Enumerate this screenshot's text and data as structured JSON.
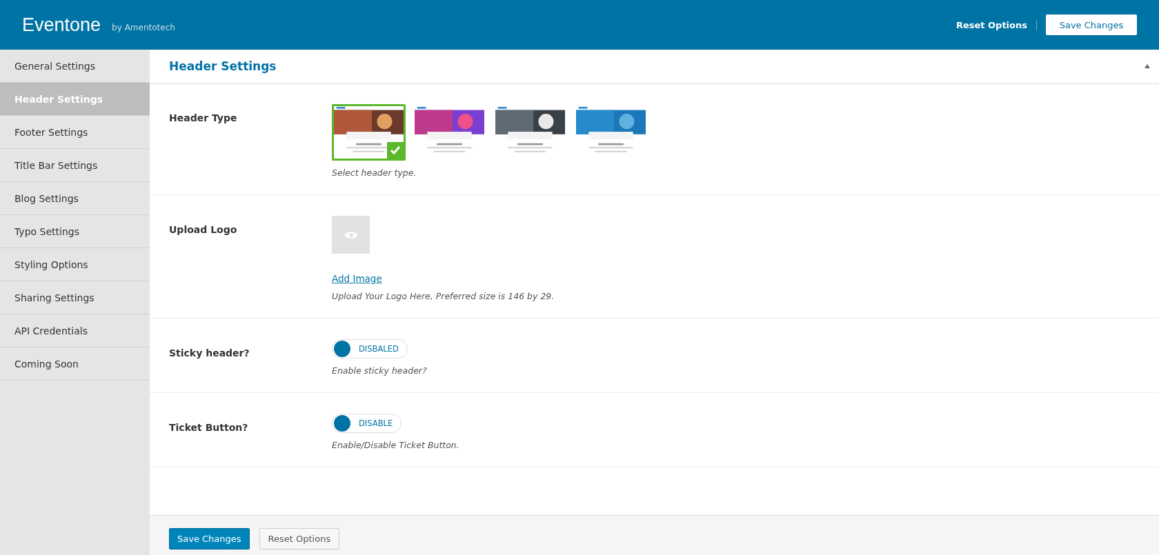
{
  "topbar": {
    "title": "Eventone",
    "subtitle": "by Amentotech",
    "reset_label": "Reset Options",
    "save_label": "Save Changes"
  },
  "sidebar": {
    "items": [
      {
        "label": "General Settings",
        "selected": false
      },
      {
        "label": "Header Settings",
        "selected": true
      },
      {
        "label": "Footer Settings",
        "selected": false
      },
      {
        "label": "Title Bar Settings",
        "selected": false
      },
      {
        "label": "Blog Settings",
        "selected": false
      },
      {
        "label": "Typo Settings",
        "selected": false
      },
      {
        "label": "Styling Options",
        "selected": false
      },
      {
        "label": "Sharing Settings",
        "selected": false
      },
      {
        "label": "API Credentials",
        "selected": false
      },
      {
        "label": "Coming Soon",
        "selected": false
      }
    ]
  },
  "section": {
    "title": "Header Settings",
    "expanded": true
  },
  "fields": [
    {
      "kind": "image-select",
      "label": "Header Type",
      "options": [
        {
          "kind": "picture",
          "selected": true
        },
        {
          "kind": "picture",
          "selected": false
        },
        {
          "kind": "picture",
          "selected": false
        },
        {
          "kind": "picture",
          "selected": false
        }
      ],
      "description": "Select header type."
    },
    {
      "kind": "upload",
      "label": "Upload Logo",
      "link": "Add Image",
      "description": "Upload Your Logo Here, Preferred size is 146 by 29."
    },
    {
      "kind": "switch",
      "label": "Sticky header?",
      "on": false,
      "state_text": "DISBALED",
      "description": "Enable sticky header?"
    },
    {
      "kind": "switch",
      "label": "Ticket Button?",
      "on": false,
      "state_text": "DISABLE",
      "description": "Enable/Disable Ticket Button."
    }
  ],
  "footer": {
    "save_label": "Save Changes",
    "reset_label": "Reset Options"
  }
}
